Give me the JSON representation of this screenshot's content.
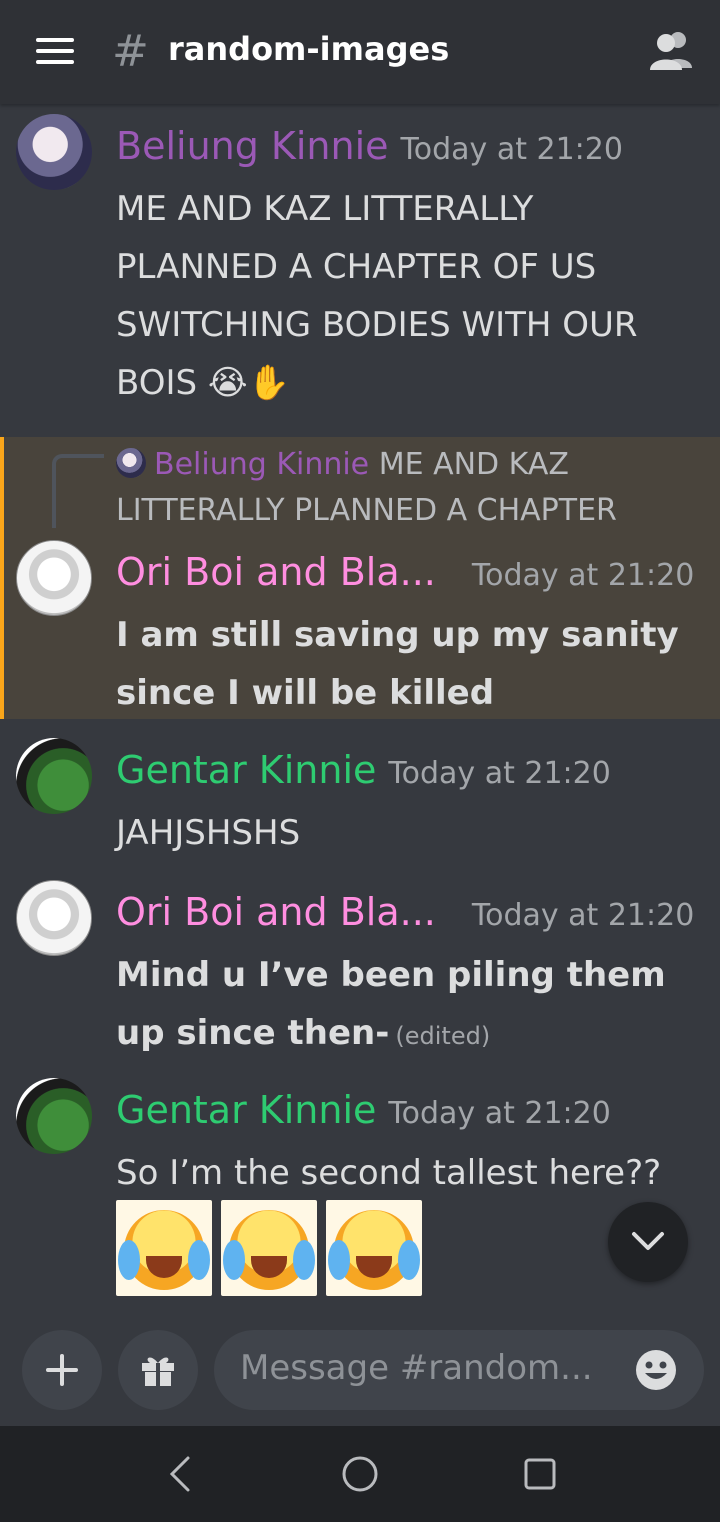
{
  "header": {
    "hash": "#",
    "channel_name": "random-images",
    "menu_icon": "hamburger-menu-icon",
    "members_icon": "members-icon"
  },
  "messages": [
    {
      "username": "Beliung Kinnie",
      "username_color": "#9b59b6",
      "timestamp": "Today at 21:20",
      "text": "ME AND KAZ LITTERALLY PLANNED A CHAPTER OF US SWITCHING BODIES WITH OUR BOIS 😭✋"
    },
    {
      "reply": {
        "username": "Beliung Kinnie",
        "text": "ME AND KAZ LITTERALLY PLANNED A CHAPTER"
      },
      "username": "Ori Boi and Bla...",
      "username_color": "#ff8ee0",
      "timestamp": "Today at 21:20",
      "text": "I am still saving up my sanity since I will be killed",
      "highlighted": true
    },
    {
      "username": "Gentar Kinnie",
      "username_color": "#2ecc71",
      "timestamp": "Today at 21:20",
      "text": "JAHJSHSHS"
    },
    {
      "username": "Ori Boi and Bla...",
      "username_color": "#ff8ee0",
      "timestamp": "Today at 21:20",
      "text": "Mind u I’ve been piling them up since then-",
      "edited": "(edited)"
    },
    {
      "username": "Gentar Kinnie",
      "username_color": "#2ecc71",
      "timestamp": "Today at 21:20",
      "text": "So I’m the second tallest here??",
      "attachments": [
        "laughing-crying-emoji-image",
        "laughing-crying-emoji-image",
        "laughing-crying-emoji-image"
      ]
    }
  ],
  "composer": {
    "placeholder": "Message #random...",
    "add_icon": "plus-icon",
    "gift_icon": "gift-icon",
    "emoji_icon": "smiley-face-icon"
  },
  "scroll_button_icon": "chevron-down-icon",
  "navbar": {
    "back_icon": "back-triangle-icon",
    "home_icon": "home-circle-icon",
    "recents_icon": "recents-square-icon"
  },
  "colors": {
    "background": "#36393f",
    "header": "#2f3136",
    "mention_highlight": "#49443c",
    "mention_bar": "#faa61a"
  }
}
